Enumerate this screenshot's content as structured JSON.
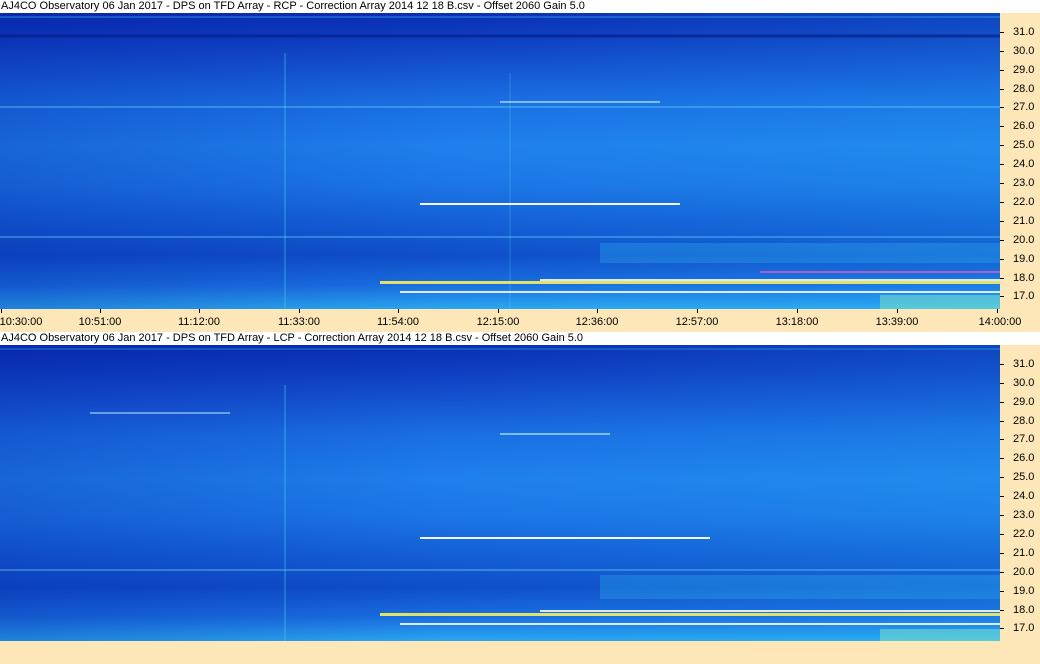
{
  "panels": [
    {
      "id": "rcp",
      "title": "AJ4CO Observatory 06 Jan 2017  -  DPS on TFD Array  -  RCP  -  Correction Array 2014 12 18 B.csv  -  Offset 2060  Gain 5.0",
      "freq_labels": [
        "31.0",
        "30.0",
        "29.0",
        "28.0",
        "27.0",
        "26.0",
        "25.0",
        "24.0",
        "23.0",
        "22.0",
        "21.0",
        "20.0",
        "19.0",
        "18.0",
        "17.0"
      ],
      "time_labels": [
        "10:30:00",
        "10:51:00",
        "11:12:00",
        "11:33:00",
        "11:54:00",
        "12:15:00",
        "12:36:00",
        "12:57:00",
        "13:18:00",
        "13:39:00",
        "14:00:00"
      ]
    },
    {
      "id": "lcp",
      "title": "AJ4CO Observatory 06 Jan 2017  -  DPS on TFD Array  -  LCP  -  Correction Array 2014 12 18 B.csv  -  Offset 2060  Gain 5.0",
      "freq_labels": [
        "31.0",
        "30.0",
        "29.0",
        "28.0",
        "27.0",
        "26.0",
        "25.0",
        "24.0",
        "23.0",
        "22.0",
        "21.0",
        "20.0",
        "19.0",
        "18.0",
        "17.0"
      ],
      "time_labels": []
    }
  ],
  "colors": {
    "axis_background": "#fde7b8",
    "title_background": "#ffffff",
    "spectrogram_deep": "#0a2fb4",
    "spectrogram_mid": "#1f80ec",
    "spectrogram_light": "#2aa8f0",
    "burst_white": "#ffffff",
    "burst_yellow": "#f6f05a",
    "burst_magenta": "#e060c0"
  }
}
